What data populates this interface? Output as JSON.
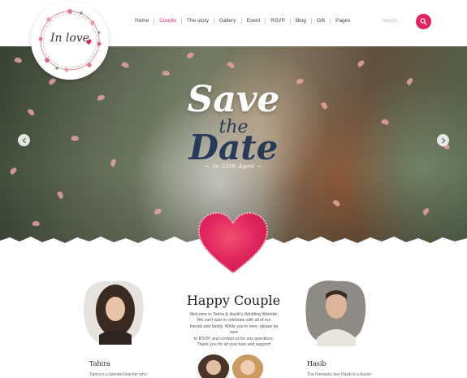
{
  "logo": {
    "text": "In love"
  },
  "nav": {
    "items": [
      "Home",
      "Couple",
      "The story",
      "Gallery",
      "Event",
      "RSVP",
      "Blog",
      "Gift",
      "Pages"
    ],
    "active_index": 1
  },
  "search": {
    "placeholder": "Search..."
  },
  "hero": {
    "title_line1": "Save",
    "title_line2": "the",
    "title_line3": "Date",
    "subtitle": "~ In 23th April ~"
  },
  "couple": {
    "title": "Happy Couple",
    "lines": [
      "Welcome to Tahira & Hasib's Wedding Website.",
      "We can't wait to celebrate with all of our",
      "friends and family. While you're here, please be sure",
      "to RSVP, and contact us for any questions.",
      "Thank you for all your love and support!"
    ],
    "bride": {
      "name": "Tahira",
      "desc": "Tahira is a talented teacher who"
    },
    "groom": {
      "name": "Hasib",
      "desc": "The Romantic boy Hasib is a doctor"
    }
  },
  "colors": {
    "accent": "#e0245e",
    "navy": "#283a5a"
  },
  "icons": {
    "search": "search-icon",
    "prev": "chevron-left-icon",
    "next": "chevron-right-icon",
    "heart": "heart-icon"
  }
}
